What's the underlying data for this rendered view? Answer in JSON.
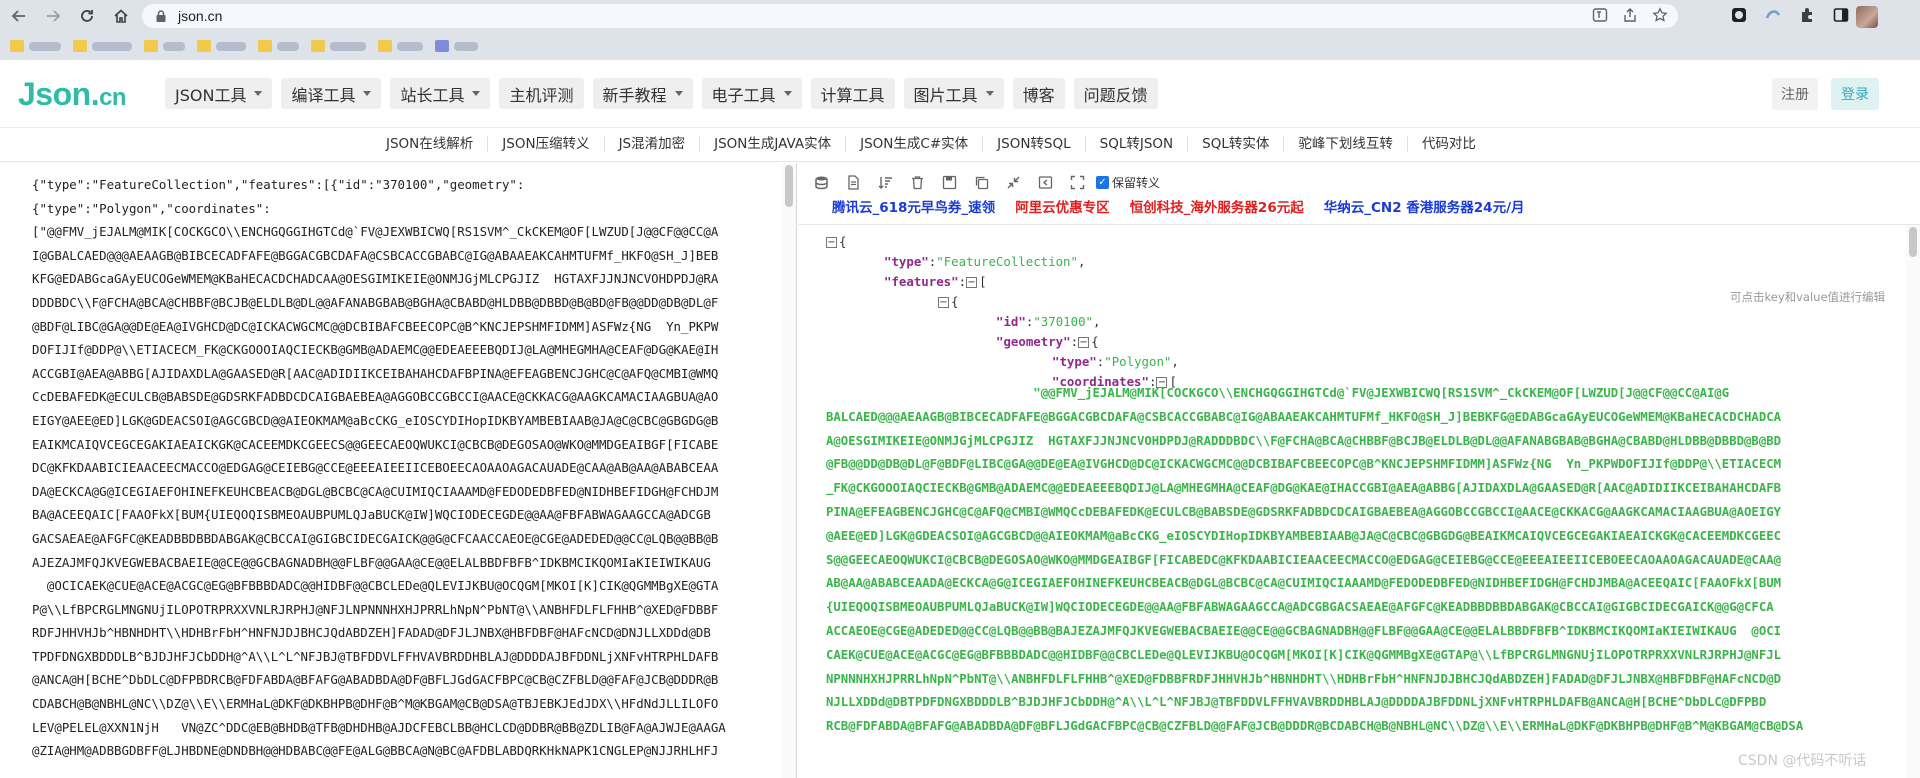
{
  "browser": {
    "url": "json.cn",
    "bookmarks": [
      {
        "label": ""
      },
      {
        "label": ""
      },
      {
        "label": ""
      },
      {
        "label": ""
      },
      {
        "label": ""
      },
      {
        "label": ""
      },
      {
        "label": ""
      },
      {
        "label": ""
      }
    ]
  },
  "site": {
    "logo_main": "Json.",
    "logo_suffix": "cn",
    "nav": [
      {
        "label": "JSON工具",
        "dropdown": true
      },
      {
        "label": "编译工具",
        "dropdown": true
      },
      {
        "label": "站长工具",
        "dropdown": true
      },
      {
        "label": "主机评测",
        "dropdown": false
      },
      {
        "label": "新手教程",
        "dropdown": true
      },
      {
        "label": "电子工具",
        "dropdown": true
      },
      {
        "label": "计算工具",
        "dropdown": false
      },
      {
        "label": "图片工具",
        "dropdown": true
      },
      {
        "label": "博客",
        "dropdown": false
      },
      {
        "label": "问题反馈",
        "dropdown": false
      }
    ],
    "login": "注册",
    "register": "登录",
    "sub_nav": [
      "JSON在线解析",
      "JSON压缩转义",
      "JS混淆加密",
      "JSON生成JAVA实体",
      "JSON生成C#实体",
      "JSON转SQL",
      "SQL转JSON",
      "SQL转实体",
      "驼峰下划线互转",
      "代码对比"
    ]
  },
  "editor": {
    "lines": [
      "{\"type\":\"FeatureCollection\",\"features\":[{\"id\":\"370100\",\"geometry\":",
      "{\"type\":\"Polygon\",\"coordinates\":",
      "[\"@@FMV_jEJALM@MIK[COCKGCO\\\\ENCHGQGGIHGTCd@`FV@JEXWBICWQ[RS1SVM^_CkCKEM@OF[LWZUD[J@@CF@@CC@A",
      "I@GBALCAED@@@AEAAGB@BIBCECADFAFE@BGGACGBCDAFA@CSBCACCGBABC@IG@ABAAEAKCAHMTUFMf_HKFO@SH_J]BEB",
      "KFG@EDABGcaGAyEUCOGeWMEM@KBaHECACDCHADCAA@OESGIMIKEIE@ONMJGjMLCPGJIZ  HGTAXFJJNJNCVOHDPDJ@RA",
      "DDDBDC\\\\F@FCHA@BCA@CHBBF@BCJB@ELDLB@DL@@AFANABGBAB@BGHA@CBABD@HLDBB@DBBD@B@BD@FB@@DD@DB@DL@F",
      "@BDF@LIBC@GA@@DE@EA@IVGHCD@DC@ICKACWGCMC@@DCBIBAFCBEECOPC@B^KNCJEPSHMFIDMM]ASFWz{NG  Yn_PKPW",
      "DOFIJIf@DDP@\\\\ETIACECM_FK@CKGOOOIAQCIECKB@GMB@ADAEMC@@EDEAEEEBQDIJ@LA@MHEGMHA@CEAF@DG@KAE@IH",
      "ACCGBI@AEA@ABBG[AJIDAXDLA@GAASED@R[AAC@ADIDIIKCEIBAHAHCDAFBPINA@EFEAGBENCJGHC@C@AFQ@CMBI@WMQ",
      "CcDEBAFEDK@ECULCB@BABSDE@GDSRKFADBDCDCAIGBAEBEA@AGGOBCCGBCCI@AACE@CKKACG@AAGKCAMACIAAGBUA@AO",
      "EIGY@AEE@ED]LGK@GDEACSOI@AGCGBCD@@AIEOKMAM@aBcCKG_eIOSCYDIHopIDKBYAMBEBIAAB@JA@C@CBC@GBGDG@B",
      "EAIKMCAIQVCEGCEGAKIAEAICKGK@CACEEMDKCGEECS@@GEECAEOQWUKCI@CBCB@DEGOSAO@WKO@MMDGEAIBGF[FICABE",
      "DC@KFKDAABICIEAACEECMACCO@EDGAG@CEIEBG@CCE@EEEAIEEIICEBOEECAOAAOAGACAUADE@CAA@AB@AA@ABABCEAA",
      "DA@ECKCA@G@ICEGIAEFOHINEFKEUHCBEACB@DGL@BCBC@CA@CUIMIQCIAAAMD@FEDODEDBFED@NIDHBEFIDGH@FCHDJM",
      "BA@ACEEQAIC[FAAOFkX[BUM{UIEQOQISBMEOAUBPUMLQJaBUCK@IW]WQCIODECEGDE@@AA@FBFABWAGAAGCCA@ADCGB",
      "GACSAEAE@AFGFC@KEADBBDBBDABGAK@CBCCAI@GIGBCIDECGAICK@@G@CFCAACCAEOE@CGE@ADEDED@@CC@LQB@@BB@B",
      "AJEZAJMFQJKVEGWEBACBAEIE@@CE@@GCBAGNADBH@@FLBF@@GAA@CE@@ELALBBDFBFB^IDKBMCIKQOMIaKIEIWIKAUG",
      "  @OCICAEK@CUE@ACE@ACGC@EG@BFBBBDADC@@HIDBF@@CBCLEDe@QLEVIJKBU@OCQGM[MKOI[K]CIK@QGMMBgXE@GTA",
      "P@\\\\LfBPCRGLMNGNUjILOPOTRPRXXVNLRJRPHJ@NFJLNPNNNHXHJPRRLhNpN^PbNT@\\\\ANBHFDLFLFHHB^@XED@FDBBF",
      "RDFJHHVHJb^HBNHDHT\\\\HDHBrFbH^HNFNJDJBHCJQdABDZEH]FADAD@DFJLJNBX@HBFDBF@HAFcNCD@DNJLLXDDd@DB",
      "TPDFDNGXBDDDLB^BJDJHFJCbDDH@^A\\\\L^L^NFJBJ@TBFDDVLFFHVAVBRDDHBLAJ@DDDDAJBFDDNLjXNFvHTRPHLDAFB",
      "@ANCA@H[BCHE^DbDLC@DFPBDRCB@FDFABDA@BFAFG@ABADBDA@DF@BFLJGdGACFBPC@CB@CZFBLD@@FAF@JCB@DDDR@B",
      "CDABCH@B@NBHL@NC\\\\DZ@\\\\E\\\\ERMHaL@DKF@DKBHPB@DHF@B^M@KBGAM@CB@DSA@TBJEBKJEdJDX\\\\HFdNdJLLILOFO",
      "LEV@PELEL@XXN1NjH   VN@ZC^DDC@EB@BHDB@TFB@DHDHB@AJDCFEBCLBB@HCLCD@DDBR@BB@ZDLIB@FA@AJWJE@AAGA",
      "@ZIA@HM@ADBBGDBFF@LJHBDNE@DNDBH@@HDBABC@@FE@ALG@BBCA@N@BC@AFDBLABDQRKHkNAPK1CNGLEP@NJJRHLHFJ"
    ]
  },
  "viewer": {
    "keep_escape_label": "保留转义",
    "ads": [
      "腾讯云_618元早鸟券_速领",
      "阿里云优惠专区",
      "恒创科技_海外服务器26元起",
      "华纳云_CN2 香港服务器24元/月"
    ],
    "hint": "可点击key和value值进行编辑",
    "tree": {
      "type_key": "\"type\"",
      "type_val": "\"FeatureCollection\"",
      "features_key": "\"features\"",
      "id_key": "\"id\"",
      "id_val": "\"370100\"",
      "geometry_key": "\"geometry\"",
      "gtype_key": "\"type\"",
      "gtype_val": "\"Polygon\"",
      "coords_key": "\"coordinates\""
    },
    "coord_lines": [
      "                            \"@@FMV_jEJALM@MIK[COCKGCO\\\\ENCHGQGGIHGTCd@`FV@JEXWBICWQ[RS1SVM^_CkCKEM@OF[LWZUD[J@@CF@@CC@AI@G",
      "BALCAED@@@AEAAGB@BIBCECADFAFE@BGGACGBCDAFA@CSBCACCGBABC@IG@ABAAEAKCAHMTUFMf_HKFO@SH_J]BEBKFG@EDABGcaGAyEUCOGeWMEM@KBaHECACDCHADCA",
      "A@OESGIMIKEIE@ONMJGjMLCPGJIZ  HGTAXFJJNJNCVOHDPDJ@RADDDBDC\\\\F@FCHA@BCA@CHBBF@BCJB@ELDLB@DL@@AFANABGBAB@BGHA@CBABD@HLDBB@DBBD@B@BD",
      "@FB@@DD@DB@DL@F@BDF@LIBC@GA@@DE@EA@IVGHCD@DC@ICKACWGCMC@@DCBIBAFCBEECOPC@B^KNCJEPSHMFIDMM]ASFWz{NG  Yn_PKPWDOFIJIf@DDP@\\\\ETIACECM",
      "_FK@CKGOOOIAQCIECKB@GMB@ADAEMC@@EDEAEEEBQDIJ@LA@MHEGMHA@CEAF@DG@KAE@IHACCGBI@AEA@ABBG[AJIDAXDLA@GAASED@R[AAC@ADIDIIKCEIBAHAHCDAFB",
      "PINA@EFEAGBENCJGHC@C@AFQ@CMBI@WMQCcDEBAFEDK@ECULCB@BABSDE@GDSRKFADBDCDCAIGBAEBEA@AGGOBCCGBCCI@AACE@CKKACG@AAGKCAMACIAAGBUA@AOEIGY",
      "@AEE@ED]LGK@GDEACSOI@AGCGBCD@@AIEOKMAM@aBcCKG_eIOSCYDIHopIDKBYAMBEBIAAB@JA@C@CBC@GBGDG@BEAIKMCAIQVCEGCEGAKIAEAICKGK@CACEEMDKCGEEC",
      "S@@GEECAEOQWUKCI@CBCB@DEGOSAO@WKO@MMDGEAIBGF[FICABEDC@KFKDAABICIEAACEECMACCO@EDGAG@CEIEBG@CCE@EEEAIEEIICEBOEECAOAAOAGACAUADE@CAA@",
      "AB@AA@ABABCEAADA@ECKCA@G@ICEGIAEFOHINEFKEUHCBEACB@DGL@BCBC@CA@CUIMIQCIAAAMD@FEDODEDBFED@NIDHBEFIDGH@FCHDJMBA@ACEEQAIC[FAAOFkX[BUM",
      "{UIEQOQISBMEOAUBPUMLQJaBUCK@IW]WQCIODECEGDE@@AA@FBFABWAGAAGCCA@ADCGBGACSAEAE@AFGFC@KEADBBDBBDABGAK@CBCCAI@GIGBCIDECGAICK@@G@CFCA",
      "ACCAEOE@CGE@ADEDED@@CC@LQB@@BB@BAJEZAJMFQJKVEGWEBACBAEIE@@CE@@GCBAGNADBH@@FLBF@@GAA@CE@@ELALBBDFBFB^IDKBMCIKQOMIaKIEIWIKAUG  @OCI",
      "CAEK@CUE@ACE@ACGC@EG@BFBBBDADC@@HIDBF@@CBCLEDe@QLEVIJKBU@OCQGM[MKOI[K]CIK@QGMMBgXE@GTAP@\\\\LfBPCRGLMNGNUjILOPOTRPRXXVNLRJRPHJ@NFJL",
      "NPNNNHXHJPRRLhNpN^PbNT@\\\\ANBHFDLFLFHHB^@XED@FDBBFRDFJHHVHJb^HBNHDHT\\\\HDHBrFbH^HNFNJDJBHCJQdABDZEH]FADAD@DFJLJNBX@HBFDBF@HAFcNCD@D",
      "NJLLXDDd@DBTPDFDNGXBDDDLB^BJDJHFJCbDDH@^A\\\\L^L^NFJBJ@TBFDDVLFFHVAVBRDDHBLAJ@DDDDAJBFDDNLjXNFvHTRPHLDAFB@ANCA@H[BCHE^DbDLC@DFPBD",
      "RCB@FDFABDA@BFAFG@ABADBDA@DF@BFLJGdGACFBPC@CB@CZFBLD@@FAF@JCB@DDDR@BCDABCH@B@NBHL@NC\\\\DZ@\\\\E\\\\ERMHaL@DKF@DKBHPB@DHF@B^M@KBGAM@CB@DSA"
    ],
    "watermark": "CSDN @代码不听话"
  }
}
